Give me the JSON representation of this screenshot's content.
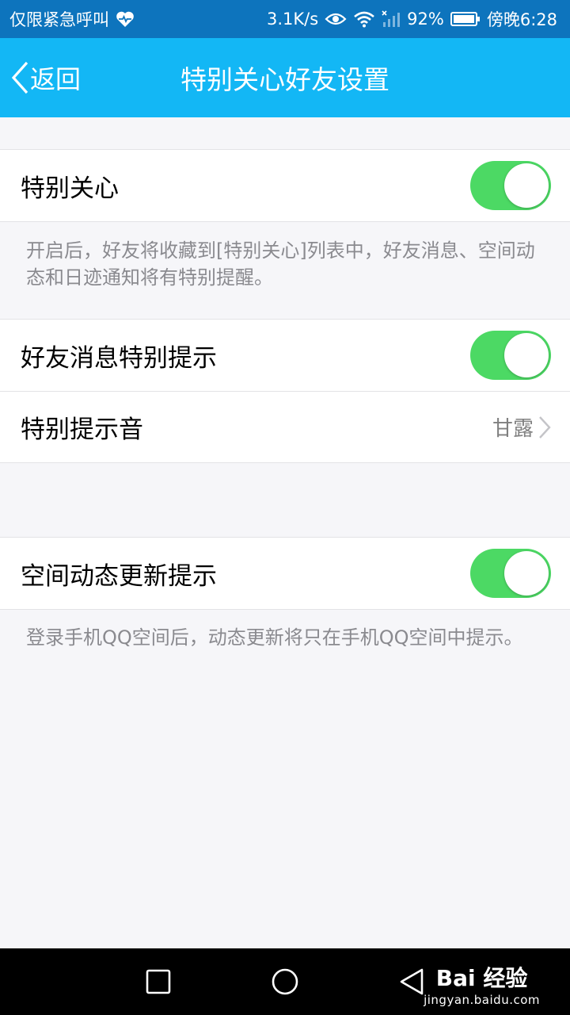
{
  "status_bar": {
    "carrier_text": "仅限紧急呼叫",
    "net_speed": "3.1K/s",
    "battery_percent": "92%",
    "time": "傍晚6:28",
    "icons": [
      "heart-rate-icon",
      "eye-icon",
      "wifi-icon",
      "signal-icon",
      "battery-icon"
    ]
  },
  "nav_bar": {
    "back_label": "返回",
    "title": "特别关心好友设置"
  },
  "settings": {
    "special_care": {
      "label": "特别关心",
      "enabled": true
    },
    "special_care_desc": "开启后，好友将收藏到[特别关心]列表中，好友消息、空间动态和日迹通知将有特别提醒。",
    "friend_message_alert": {
      "label": "好友消息特别提示",
      "enabled": true
    },
    "special_ringtone": {
      "label": "特别提示音",
      "value": "甘露"
    },
    "qzone_update_alert": {
      "label": "空间动态更新提示",
      "enabled": true
    },
    "qzone_update_desc": "登录手机QQ空间后，动态更新将只在手机QQ空间中提示。"
  },
  "system_nav": {
    "icons": [
      "recent-apps-icon",
      "home-icon",
      "back-triangle-icon"
    ]
  },
  "watermark": {
    "brand": "Bai 经验",
    "url": "jingyan.baidu.com"
  },
  "colors": {
    "status_bar": "#0d74bd",
    "nav_bar": "#13b7f5",
    "toggle_on": "#4cd964",
    "page_bg": "#f6f6f9"
  }
}
